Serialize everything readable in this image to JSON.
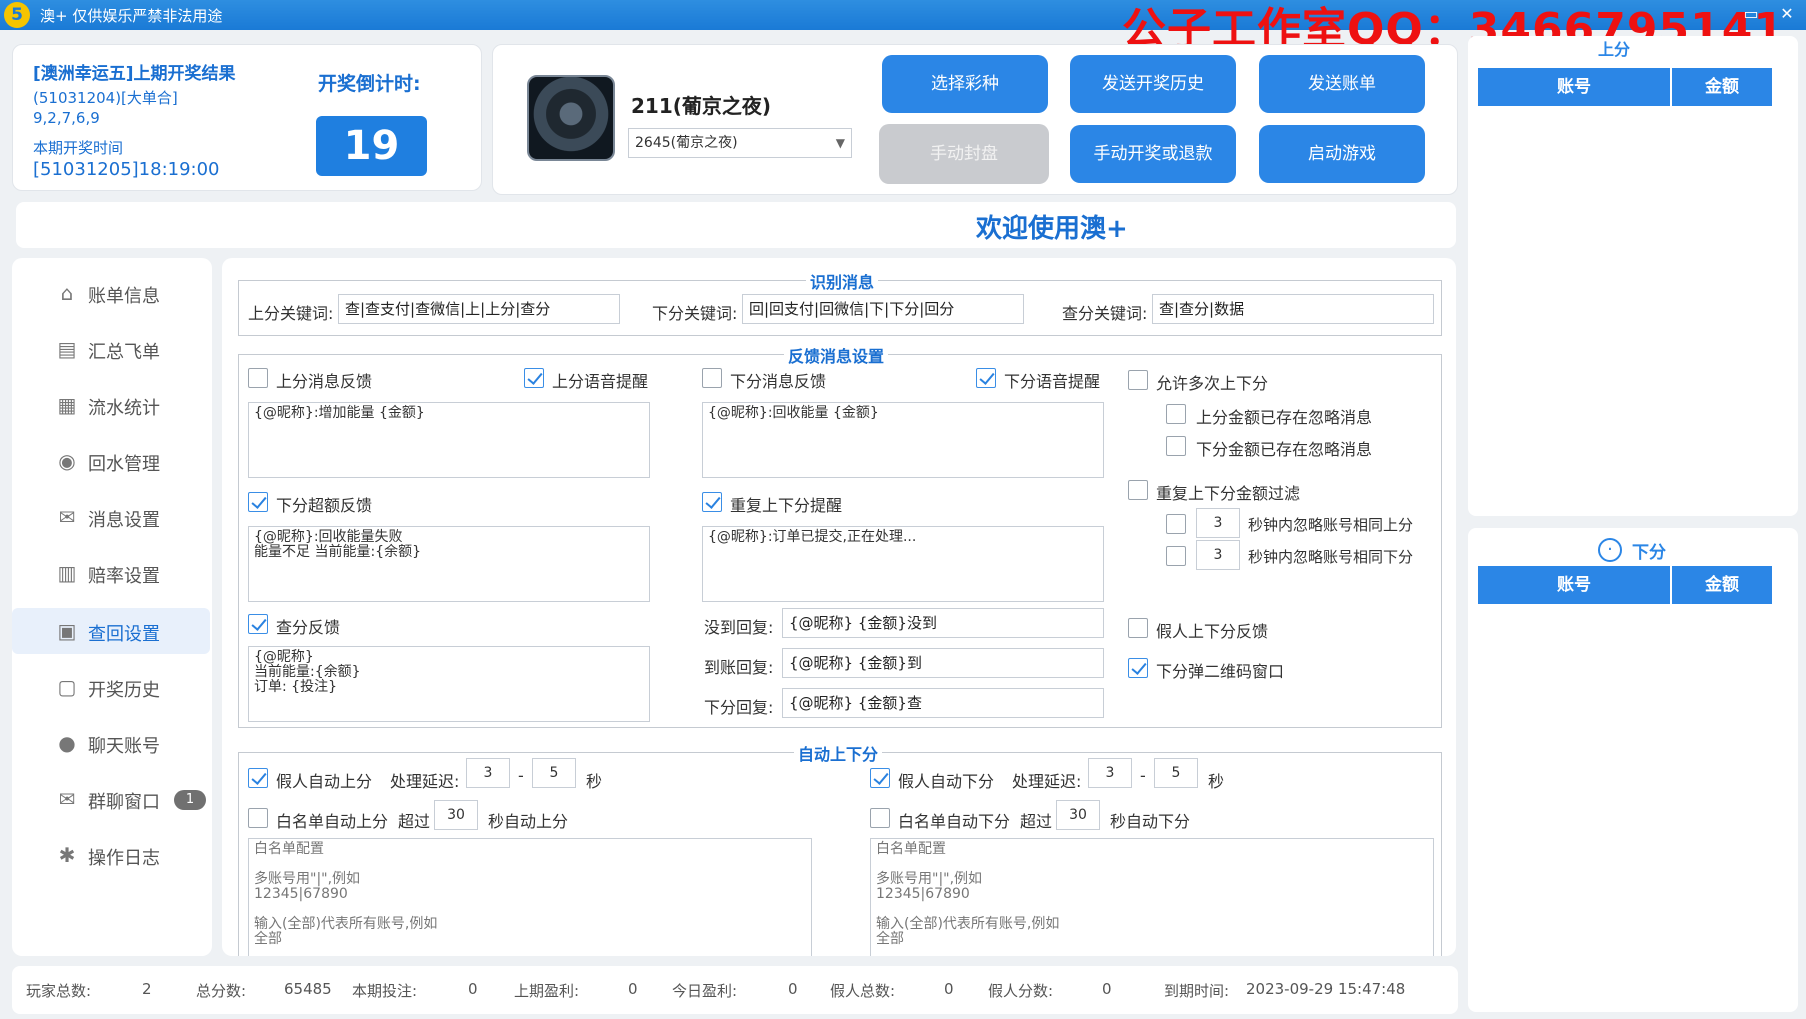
{
  "titlebar": {
    "logo": "5",
    "title": "澳+ 仅供娱乐严禁非法用途",
    "watermark": "公子工作室QQ：3466795141",
    "min": "▭",
    "close": "✕"
  },
  "draw": {
    "title": "[澳洲幸运五]上期开奖结果",
    "issue": "(51031204)[大单合]",
    "numbers": "9,2,7,6,9",
    "time_label": "本期开奖时间",
    "time_value": "[51031205]18:19:00",
    "countdown_label": "开奖倒计时:",
    "countdown_value": "19"
  },
  "game": {
    "name": "211(葡京之夜)",
    "selected": "2645(葡京之夜)"
  },
  "buttons": {
    "select_lottery": "选择彩种",
    "send_history": "发送开奖历史",
    "send_bill": "发送账单",
    "manual_seal": "手动封盘",
    "manual_draw": "手动开奖或退款",
    "start_game": "启动游戏"
  },
  "welcome": "欢迎使用澳+",
  "sidebar": [
    {
      "icon": "⌂",
      "label": "账单信息"
    },
    {
      "icon": "▤",
      "label": "汇总飞单"
    },
    {
      "icon": "▦",
      "label": "流水统计"
    },
    {
      "icon": "◉",
      "label": "回水管理"
    },
    {
      "icon": "✉",
      "label": "消息设置"
    },
    {
      "icon": "▥",
      "label": "赔率设置"
    },
    {
      "icon": "▣",
      "label": "查回设置"
    },
    {
      "icon": "▢",
      "label": "开奖历史"
    },
    {
      "icon": "●",
      "label": "聊天账号"
    },
    {
      "icon": "✉",
      "label": "群聊窗口",
      "badge": "1"
    },
    {
      "icon": "✱",
      "label": "操作日志"
    }
  ],
  "recognize": {
    "title": "识别消息",
    "up_label": "上分关键词:",
    "up_value": "查|查支付|查微信|上|上分|查分",
    "down_label": "下分关键词:",
    "down_value": "回|回支付|回微信|下|下分|回分",
    "query_label": "查分关键词:",
    "query_value": "查|查分|数据"
  },
  "feedback": {
    "title": "反馈消息设置",
    "up_msg": "上分消息反馈",
    "up_voice": "上分语音提醒",
    "down_msg": "下分消息反馈",
    "down_voice": "下分语音提醒",
    "up_tpl": "{@昵称}:增加能量 {金额}",
    "down_tpl": "{@昵称}:回收能量 {金额}",
    "over_label": "下分超额反馈",
    "over_tpl": "{@昵称}:回收能量失败\n能量不足 当前能量:{余额}",
    "repeat_label": "重复上下分提醒",
    "repeat_tpl": "{@昵称}:订单已提交,正在处理...",
    "query_label": "查分反馈",
    "query_tpl": "{@昵称}\n当前能量:{余额}\n订单: {投注}",
    "not_arrived_label": "没到回复:",
    "not_arrived_value": "{@昵称} {金额}没到",
    "arrived_label": "到账回复:",
    "arrived_value": "{@昵称} {金额}到",
    "down_reply_label": "下分回复:",
    "down_reply_value": "{@昵称} {金额}查",
    "allow_multi": "允许多次上下分",
    "up_ignore": "上分金额已存在忽略消息",
    "down_ignore": "下分金额已存在忽略消息",
    "repeat_filter": "重复上下分金额过滤",
    "up_sec_value": "3",
    "up_sec_label": "秒钟内忽略账号相同上分",
    "down_sec_value": "3",
    "down_sec_label": "秒钟内忽略账号相同下分",
    "fake_feedback": "假人上下分反馈",
    "qr_popup": "下分弹二维码窗口"
  },
  "auto": {
    "title": "自动上下分",
    "fake_up": "假人自动上分",
    "fake_down": "假人自动下分",
    "delay_label": "处理延迟:",
    "up_min": "3",
    "up_max": "5",
    "down_min": "3",
    "down_max": "5",
    "dash": "-",
    "sec": "秒",
    "wl_up": "白名单自动上分",
    "wl_down": "白名单自动下分",
    "over": "超过",
    "up_secs": "30",
    "down_secs": "30",
    "up_suffix": "秒自动上分",
    "down_suffix": "秒自动下分",
    "wl_ph": "白名单配置\n\n多账号用\"|\",例如\n12345|67890\n\n输入(全部)代表所有账号,例如\n全部"
  },
  "status": {
    "players_label": "玩家总数:",
    "players": "2",
    "total_label": "总分数:",
    "total": "65485",
    "bet_label": "本期投注:",
    "bet": "0",
    "last_profit_label": "上期盈利:",
    "last_profit": "0",
    "today_profit_label": "今日盈利:",
    "today_profit": "0",
    "fake_total_label": "假人总数:",
    "fake_total": "0",
    "fake_score_label": "假人分数:",
    "fake_score": "0",
    "expire_label": "到期时间:",
    "expire": "2023-09-29 15:47:48"
  },
  "right": {
    "up_title": "上分",
    "down_title": "下分",
    "col_account": "账号",
    "col_amount": "金额"
  }
}
